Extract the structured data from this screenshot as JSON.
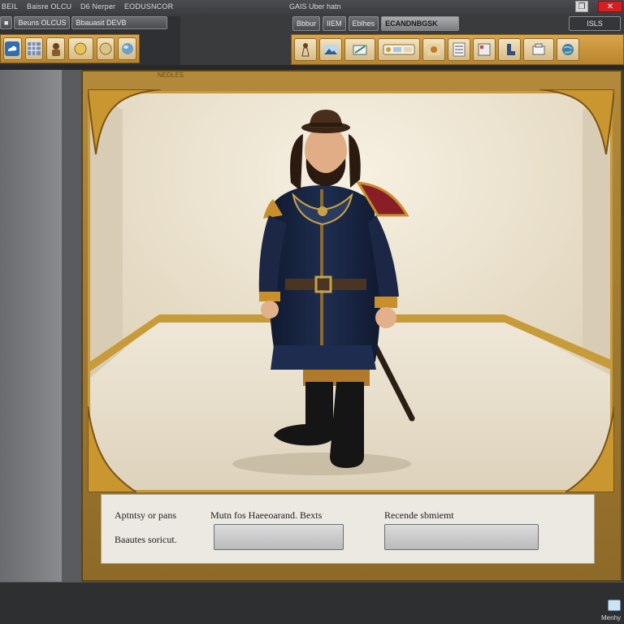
{
  "window": {
    "title_left": [
      "BEIL",
      "Baisre OLCU",
      "D6 Nerper",
      "EODUSNCOR"
    ],
    "title_center": "GAIS Uber hatn",
    "restore_label": "❐",
    "close_label": "✕"
  },
  "toolbar_left": {
    "tabs": [
      "■",
      "Beuns OLCUS",
      "Bbauasit DEVB"
    ],
    "icons": [
      "cloud-icon",
      "grid-icon",
      "character-icon",
      "coin-icon",
      "coin-icon",
      "sphere-icon",
      "coin-icon"
    ]
  },
  "toolbar_right": {
    "tabs": [
      "Bbbur",
      "IIEM",
      "Eblhes",
      "ECANDNBGSK"
    ],
    "side_tab": "ISLS",
    "icons": [
      "figure-icon",
      "landscape-icon",
      "folder-icon",
      "palette-icon",
      "image-icon",
      "list-icon",
      "doc-icon",
      "boot-icon",
      "box-icon",
      "globe-icon"
    ]
  },
  "viewport": {
    "frame_label": "NEDLES"
  },
  "properties": {
    "label_1": "Aptntsy or pans",
    "label_2": "Baautes soricut.",
    "label_3": "Mutn fos Haeeoarand. Bexts",
    "label_4": "Recende sbmiemt",
    "field_1_value": "",
    "field_2_value": ""
  },
  "status": {
    "corner_label": "Menhy"
  },
  "colors": {
    "gold": "#c99a3e",
    "dark_ui": "#3a3b3d",
    "close_red": "#d42020"
  }
}
